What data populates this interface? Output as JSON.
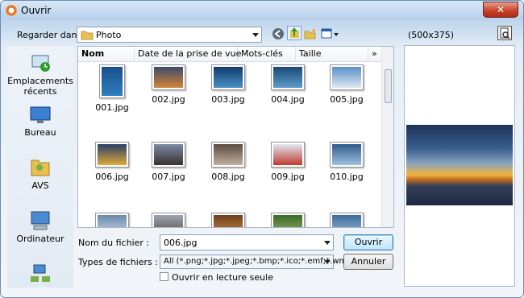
{
  "window": {
    "title": "Ouvrir",
    "close_label": "✕"
  },
  "toolbar": {
    "look_in_label": "Regarder dans :",
    "look_in_value": "Photo",
    "preview_size": "(500x375)"
  },
  "places": [
    {
      "label": "Emplacements récents",
      "icon": "recent-places-icon"
    },
    {
      "label": "Bureau",
      "icon": "desktop-icon"
    },
    {
      "label": "AVS",
      "icon": "folder-user-icon"
    },
    {
      "label": "Ordinateur",
      "icon": "computer-icon"
    },
    {
      "label": "",
      "icon": "network-icon"
    }
  ],
  "columns": [
    "Nom",
    "Date de la prise de vue",
    "Mots-clés",
    "Taille",
    "»"
  ],
  "files": [
    {
      "name": "001.jpg",
      "colors": [
        "#1a4f8a",
        "#2f7fc0"
      ]
    },
    {
      "name": "002.jpg",
      "colors": [
        "#3a4a6a",
        "#d2843a"
      ]
    },
    {
      "name": "003.jpg",
      "colors": [
        "#0f3b6b",
        "#4a8fc4"
      ]
    },
    {
      "name": "004.jpg",
      "colors": [
        "#1a4a72",
        "#5d9acb"
      ]
    },
    {
      "name": "005.jpg",
      "colors": [
        "#5b8fc4",
        "#dce8f2"
      ]
    },
    {
      "name": "006.jpg",
      "colors": [
        "#2a3e66",
        "#e0a93a"
      ]
    },
    {
      "name": "007.jpg",
      "colors": [
        "#7a8aa2",
        "#3a3030"
      ]
    },
    {
      "name": "008.jpg",
      "colors": [
        "#5a4a40",
        "#c0b0a0"
      ]
    },
    {
      "name": "009.jpg",
      "colors": [
        "#dfe8f2",
        "#c0392b"
      ]
    },
    {
      "name": "010.jpg",
      "colors": [
        "#2f5a8a",
        "#9ec3e0"
      ]
    },
    {
      "name": "",
      "colors": [
        "#6a8aaa",
        "#c8d6e4"
      ]
    },
    {
      "name": "",
      "colors": [
        "#9aa6b4",
        "#5a4a3a"
      ]
    },
    {
      "name": "",
      "colors": [
        "#6a4020",
        "#d08a3a"
      ]
    },
    {
      "name": "",
      "colors": [
        "#3a6a2a",
        "#9ab060"
      ]
    },
    {
      "name": "",
      "colors": [
        "#3a6a9a",
        "#a0c0da"
      ]
    }
  ],
  "form": {
    "filename_label": "Nom du fichier :",
    "filename_value": "006.jpg",
    "filetype_label": "Types de fichiers :",
    "filetype_value": "All (*.png;*.jpg;*.jpeg;*.bmp;*.ico;*.emf;*.wmf)",
    "readonly_label": "Ouvrir en lecture seule",
    "readonly_checked": false,
    "open_button": "Ouvrir",
    "cancel_button": "Annuler"
  }
}
